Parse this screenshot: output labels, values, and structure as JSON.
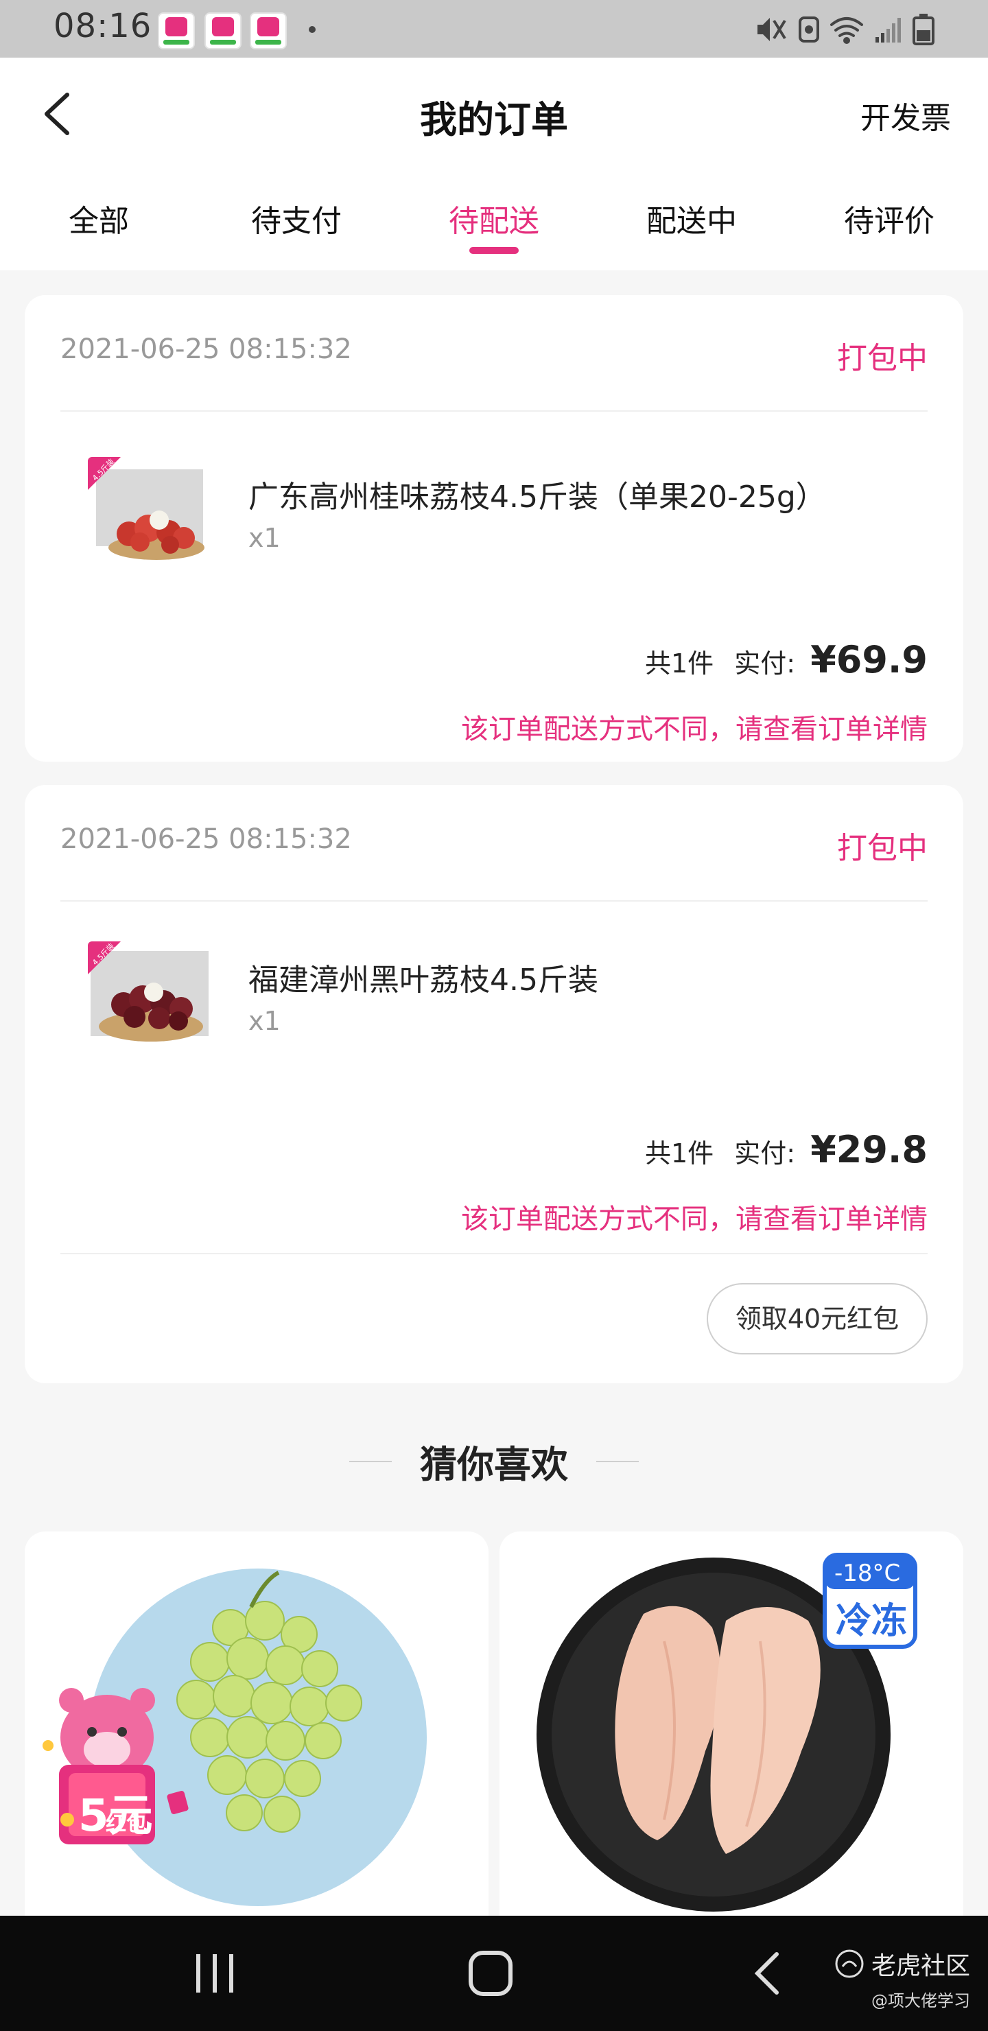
{
  "status_bar": {
    "time": "08:16"
  },
  "header": {
    "title": "我的订单",
    "invoice": "开发票"
  },
  "tabs": [
    {
      "label": "全部"
    },
    {
      "label": "待支付"
    },
    {
      "label": "待配送"
    },
    {
      "label": "配送中"
    },
    {
      "label": "待评价"
    }
  ],
  "orders": [
    {
      "time": "2021-06-25 08:15:32",
      "status": "打包中",
      "product_name": "广东高州桂味荔枝4.5斤装（单果20-25g）",
      "quantity": "x1",
      "count": "共1件",
      "paid_label": "实付:",
      "price": "¥69.9",
      "note": "该订单配送方式不同，请查看订单详情",
      "badge": "4.5斤装"
    },
    {
      "time": "2021-06-25 08:15:32",
      "status": "打包中",
      "product_name": "福建漳州黑叶荔枝4.5斤装",
      "quantity": "x1",
      "count": "共1件",
      "paid_label": "实付:",
      "price": "¥29.8",
      "note": "该订单配送方式不同，请查看订单详情",
      "badge": "4.5斤装",
      "coupon_button": "领取40元红包"
    }
  ],
  "recommend": {
    "title": "猜你喜欢",
    "items": [
      {
        "image": "green-grapes",
        "promo_amount": "5元",
        "promo_label": "红包"
      },
      {
        "image": "chicken-breast",
        "temp": "-18°C",
        "tag": "冷冻"
      }
    ]
  },
  "watermark": {
    "main": "老虎社区",
    "sub": "@项大佬学习"
  },
  "colors": {
    "accent": "#e5307e",
    "status_bar": "#c9c9c9",
    "nav_bar": "#0b0b0b"
  }
}
